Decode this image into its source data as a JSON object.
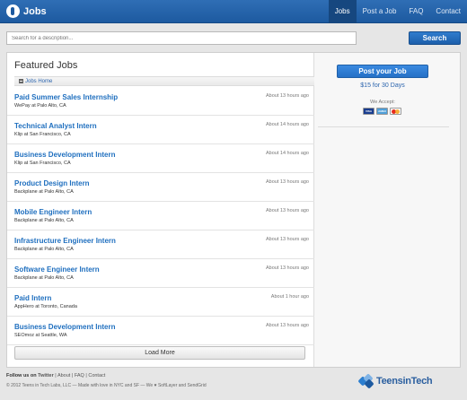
{
  "header": {
    "brand": "Jobs",
    "nav": [
      "Jobs",
      "Post a Job",
      "FAQ",
      "Contact"
    ]
  },
  "search": {
    "placeholder": "Search for a description...",
    "button": "Search"
  },
  "featured": {
    "title": "Featured Jobs",
    "breadcrumb": "Jobs Home",
    "jobs": [
      {
        "title": "Paid Summer Sales Internship",
        "company": "WePay at Palo Alto, CA",
        "time": "About 13 hours ago"
      },
      {
        "title": "Technical Analyst Intern",
        "company": "Klip at San Francisco, CA",
        "time": "About 14 hours ago"
      },
      {
        "title": "Business Development Intern",
        "company": "Klip at San Francisco, CA",
        "time": "About 14 hours ago"
      },
      {
        "title": "Product Design Intern",
        "company": "Backplane at Palo Alto, CA",
        "time": "About 13 hours ago"
      },
      {
        "title": "Mobile Engineer Intern",
        "company": "Backplane at Palo Alto, CA",
        "time": "About 13 hours ago"
      },
      {
        "title": "Infrastructure Engineer Intern",
        "company": "Backplane at Palo Alto, CA",
        "time": "About 13 hours ago"
      },
      {
        "title": "Software Engineer Intern",
        "company": "Backplane at Palo Alto, CA",
        "time": "About 13 hours ago"
      },
      {
        "title": "Paid Intern",
        "company": "AppHero at Toronto, Canada",
        "time": "About 1 hour ago"
      },
      {
        "title": "Business Development Intern",
        "company": "SEOmoz at Seattle, WA",
        "time": "About 13 hours ago"
      }
    ],
    "load_more": "Load More"
  },
  "sidebar": {
    "post_button": "Post your Job",
    "price_amount": "$15",
    "price_text": "for 30 Days",
    "we_accept": "We Accept:",
    "cards": [
      {
        "name": "visa-card-icon",
        "label": "VISA"
      },
      {
        "name": "amex-card-icon",
        "label": "AMEX"
      },
      {
        "name": "mastercard-icon",
        "label": ""
      }
    ]
  },
  "footer": {
    "follow_prefix": "Follow us on",
    "twitter": "Twitter",
    "about": "About",
    "faq": "FAQ",
    "contact": "Contact",
    "copyright": "© 2012 Teens in Tech Labs, LLC — Made with love in NYC and SF — We ♥ SoftLayer and SendGrid",
    "logo_text": "TeensinTech"
  },
  "colors": {
    "brand_blue": "#1d5aa0",
    "link_blue": "#1f6fbf"
  }
}
